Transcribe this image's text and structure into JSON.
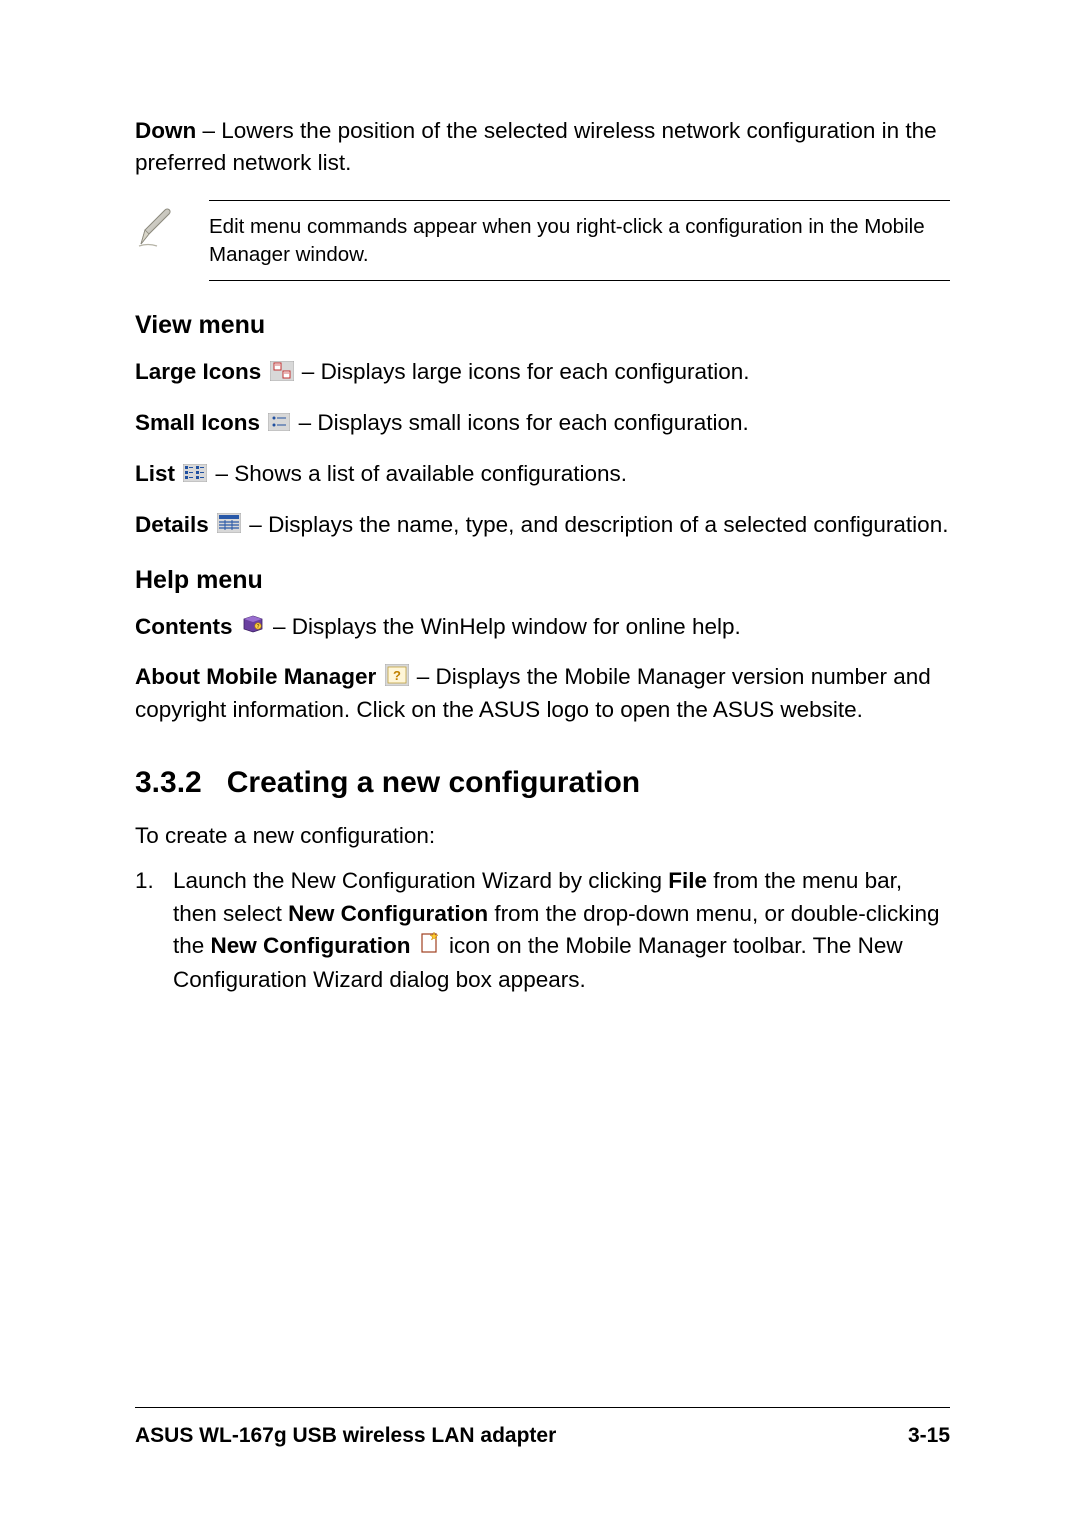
{
  "intro": {
    "down_label": "Down",
    "down_text": " – Lowers the position of the selected wireless network configuration in the preferred network list."
  },
  "note_text": "Edit menu commands appear when you right-click a configuration in the Mobile Manager window.",
  "view_menu": {
    "heading": "View menu",
    "large_icons_label": "Large Icons ",
    "large_icons_text": " – Displays large icons for each configuration.",
    "small_icons_label": "Small Icons ",
    "small_icons_text": " – Displays small icons for each configuration.",
    "list_label": "List ",
    "list_text": " – Shows a list of available configurations.",
    "details_label": "Details ",
    "details_text": " – Displays the name, type, and description of a selected configuration."
  },
  "help_menu": {
    "heading": "Help menu",
    "contents_label": "Contents ",
    "contents_text": " – Displays the WinHelp window for online help.",
    "about_label": "About Mobile Manager ",
    "about_text": " – Displays the Mobile Manager version number and copyright information. Click on the ASUS logo to open the ASUS website."
  },
  "section": {
    "heading_num": "3.3.2",
    "heading_text": "Creating a new configuration",
    "intro": "To create a new configuration:",
    "step1_num": "1.",
    "step1_a": "Launch the New Configuration Wizard by clicking ",
    "step1_b": "File",
    "step1_c": " from the menu bar, then select ",
    "step1_d": "New Configuration",
    "step1_e": " from the drop-down menu, or double-clicking the ",
    "step1_f": "New Configuration",
    "step1_g": " icon on the Mobile Manager toolbar. The New Configuration Wizard dialog box appears."
  },
  "footer": {
    "left": "ASUS WL-167g USB wireless LAN adapter",
    "right": "3-15"
  }
}
